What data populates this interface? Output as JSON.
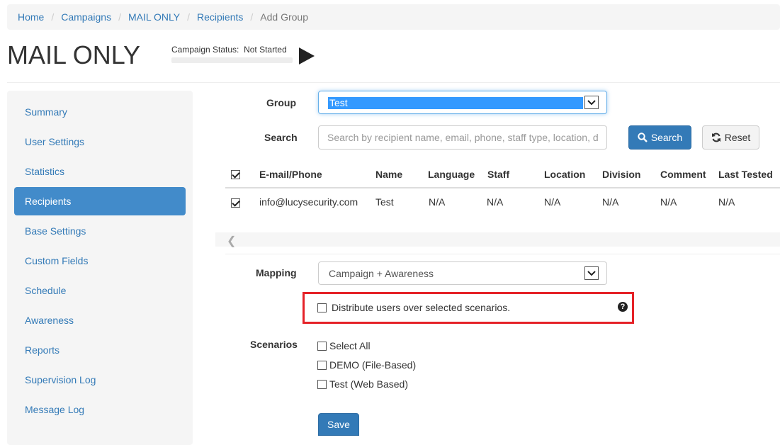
{
  "breadcrumb": [
    "Home",
    "Campaigns",
    "MAIL ONLY",
    "Recipients",
    "Add Group"
  ],
  "breadcrumb_separator": "/",
  "page": {
    "title": "MAIL ONLY"
  },
  "campaign_status": {
    "label": "Campaign Status:",
    "value": "Not Started"
  },
  "sidebar": {
    "items": [
      {
        "label": "Summary",
        "active": false
      },
      {
        "label": "User Settings",
        "active": false
      },
      {
        "label": "Statistics",
        "active": false
      },
      {
        "label": "Recipients",
        "active": true
      },
      {
        "label": "Base Settings",
        "active": false
      },
      {
        "label": "Custom Fields",
        "active": false
      },
      {
        "label": "Schedule",
        "active": false
      },
      {
        "label": "Awareness",
        "active": false
      },
      {
        "label": "Reports",
        "active": false
      },
      {
        "label": "Supervision Log",
        "active": false
      },
      {
        "label": "Message Log",
        "active": false
      }
    ]
  },
  "form": {
    "group_label": "Group",
    "group_value": "Test",
    "search_label": "Search",
    "search_placeholder": "Search by recipient name, email, phone, staff type, location, d",
    "search_button": "Search",
    "reset_button": "Reset",
    "mapping_label": "Mapping",
    "mapping_value": "Campaign + Awareness",
    "distribute_label": "Distribute users over selected scenarios.",
    "help_glyph": "?",
    "scenarios_label": "Scenarios",
    "scenarios": [
      "Select All",
      "DEMO (File-Based)",
      "Test (Web Based)"
    ],
    "save_button": "Save"
  },
  "table": {
    "headers": [
      "E-mail/Phone",
      "Name",
      "Language",
      "Staff",
      "Location",
      "Division",
      "Comment",
      "Last Tested"
    ],
    "rows": [
      [
        "info@lucysecurity.com",
        "Test",
        "N/A",
        "N/A",
        "N/A",
        "N/A",
        "N/A",
        "N/A"
      ]
    ]
  },
  "colors": {
    "accent": "#337ab7",
    "active_nav": "#428bca",
    "highlight_box": "#e52228",
    "selected_option": "#3399ff"
  },
  "icons": [
    "play-icon",
    "search-icon",
    "refresh-icon",
    "chevron-down-icon",
    "chevron-left-icon",
    "help-icon",
    "checkbox-icon"
  ]
}
